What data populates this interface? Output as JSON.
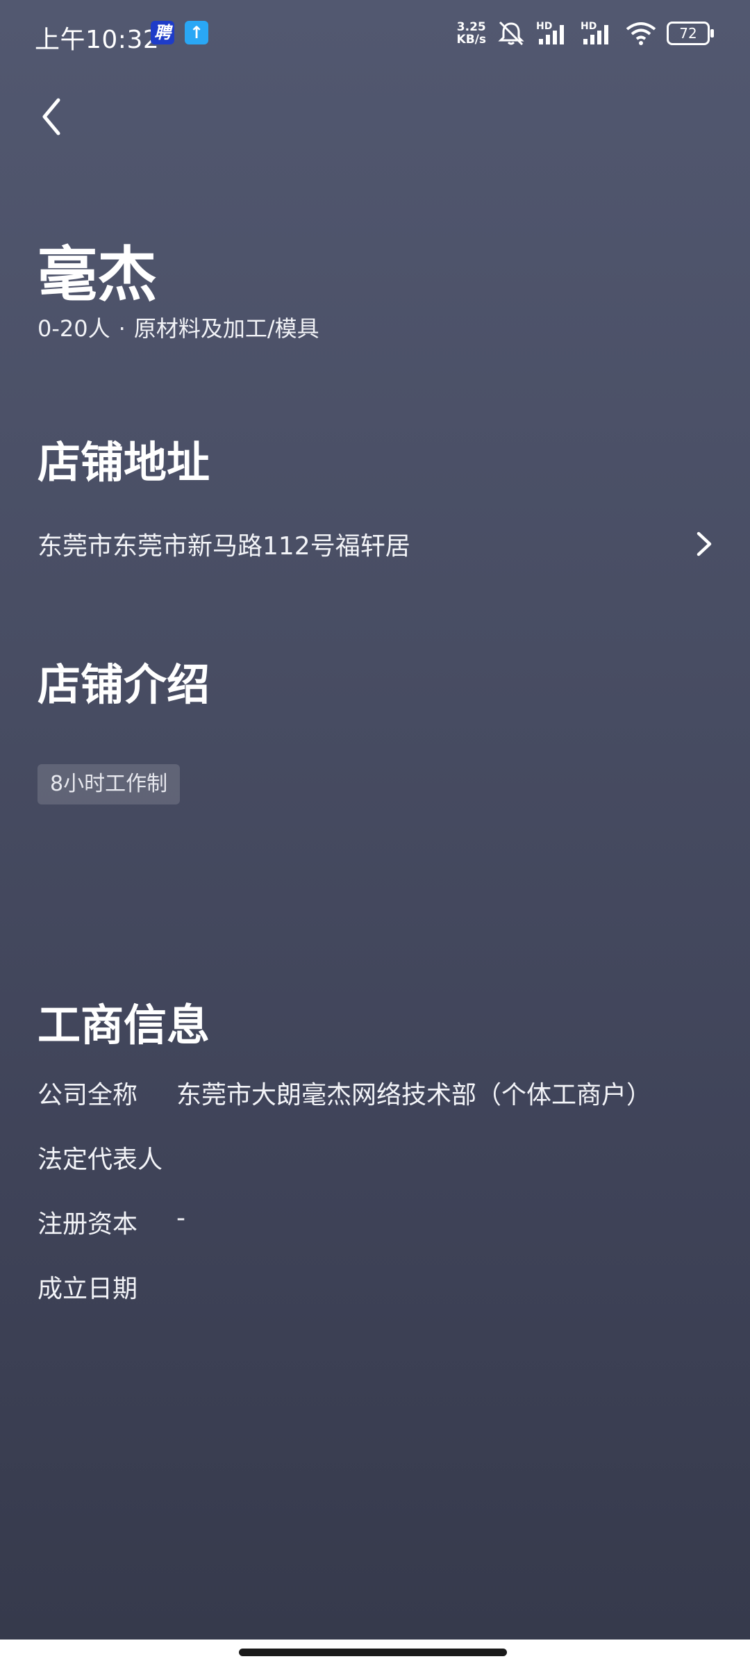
{
  "status_bar": {
    "time": "上午10:32",
    "app_icon_1": "聘",
    "app_icon_2": "↑",
    "net_speed_value": "3.25",
    "net_speed_unit": "KB/s",
    "sim1_label": "HD",
    "sim2_label": "HD",
    "battery": "72",
    "icons": [
      "mute-icon",
      "signal-icon",
      "signal-icon",
      "wifi-icon",
      "battery-icon"
    ]
  },
  "header": {
    "back_icon": "chevron-left-icon"
  },
  "shop": {
    "name": "毫杰",
    "size": "0-20人",
    "separator": "·",
    "industry": "原材料及加工/模具"
  },
  "address_section": {
    "title": "店铺地址",
    "address": "东莞市东莞市新马路112号福轩居"
  },
  "intro_section": {
    "title": "店铺介绍",
    "tags": [
      "8小时工作制"
    ]
  },
  "business_section": {
    "title": "工商信息",
    "rows": [
      {
        "label": "公司全称",
        "value": "东莞市大朗毫杰网络技术部（个体工商户）"
      },
      {
        "label": "法定代表人",
        "value": ""
      },
      {
        "label": "注册资本",
        "value": "-"
      },
      {
        "label": "成立日期",
        "value": ""
      }
    ]
  },
  "colors": {
    "background_top": "#525870",
    "background_bottom": "#363a4c",
    "text": "#ffffff"
  }
}
